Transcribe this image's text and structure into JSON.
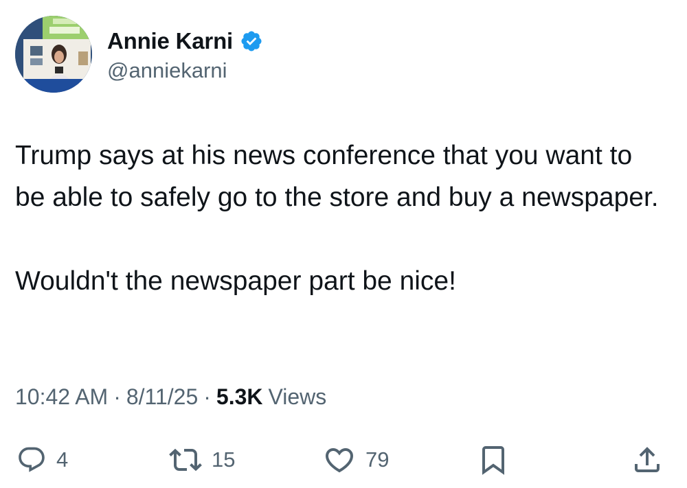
{
  "author": {
    "display_name": "Annie Karni",
    "handle": "@anniekarni",
    "verified": true,
    "verified_color": "#1d9bf0"
  },
  "tweet": {
    "text": "Trump says at his news conference that you want to be able to safely go to the store and buy a newspaper.\n\nWouldn't the newspaper part be nice!",
    "time": "10:42 AM",
    "date": "8/11/25",
    "separator": "·",
    "views_count": "5.3K",
    "views_label": "Views"
  },
  "actions": {
    "replies": "4",
    "reposts": "15",
    "likes": "79"
  },
  "icons": [
    "reply-icon",
    "repost-icon",
    "like-icon",
    "bookmark-icon",
    "share-icon",
    "verified-badge-icon"
  ],
  "colors": {
    "text_primary": "#0f1419",
    "text_secondary": "#536471"
  }
}
